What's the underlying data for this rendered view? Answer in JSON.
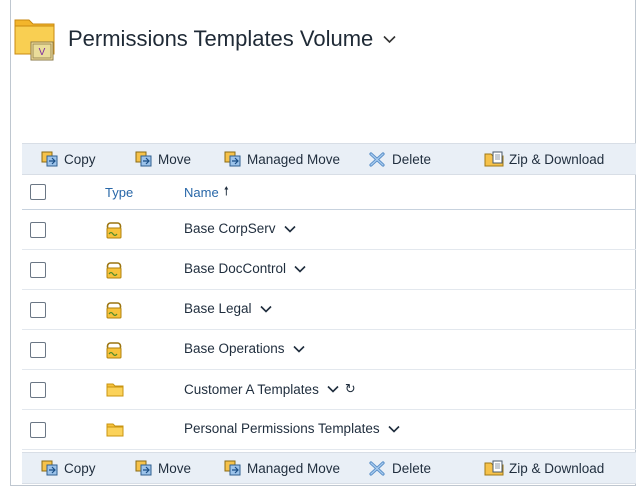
{
  "volume": {
    "title": "Permissions Templates Volume",
    "caret_icon": "chevron-down-icon",
    "icon": "volume-folder-icon"
  },
  "toolbar": {
    "copy_label": "Copy",
    "move_label": "Move",
    "managed_move_label": "Managed Move",
    "delete_label": "Delete",
    "zip_label": "Zip & Download"
  },
  "table": {
    "columns": {
      "type": "Type",
      "name": "Name"
    },
    "sort_arrow": "🠕",
    "rows": [
      {
        "name": "Base CorpServ",
        "type": "permissions-template-icon"
      },
      {
        "name": "Base DocControl",
        "type": "permissions-template-icon"
      },
      {
        "name": "Base Legal",
        "type": "permissions-template-icon"
      },
      {
        "name": "Base Operations",
        "type": "permissions-template-icon"
      },
      {
        "name": "Customer A Templates",
        "type": "folder-icon",
        "refresh": "↻"
      },
      {
        "name": "Personal Permissions Templates",
        "type": "folder-icon"
      }
    ]
  },
  "colors": {
    "toolbar_bg": "#e9eff6",
    "header_link": "#2867a8",
    "folder_yellow": "#f7c23b"
  }
}
